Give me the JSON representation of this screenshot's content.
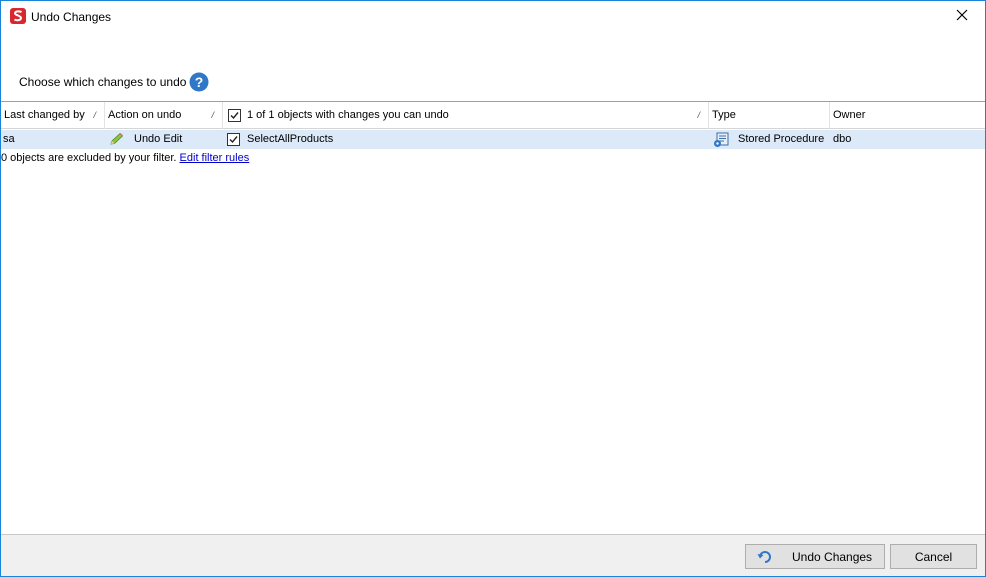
{
  "window": {
    "title": "Undo Changes"
  },
  "prompt": {
    "text": "Choose which changes to undo"
  },
  "grid": {
    "columns": {
      "last_changed_by": "Last changed by",
      "action_on_undo": "Action on undo",
      "objects_summary": "1 of 1 objects with changes you can undo",
      "type": "Type",
      "owner": "Owner"
    },
    "rows": [
      {
        "last_changed_by": "sa",
        "action": "Undo Edit",
        "checked": true,
        "object_name": "SelectAllProducts",
        "type": "Stored Procedure",
        "owner": "dbo"
      }
    ],
    "filter_note": "0 objects are excluded by your filter.",
    "filter_link": "Edit filter rules"
  },
  "footer": {
    "undo_button": "Undo Changes",
    "cancel_button": "Cancel"
  },
  "icons": {
    "app": "redgate-logo-icon",
    "help": "help-icon",
    "action": "pencil-icon",
    "type": "stored-procedure-icon",
    "undo": "undo-icon",
    "close": "close-icon"
  },
  "colors": {
    "window_border": "#1883d7",
    "selected_row": "#dce9f8",
    "link": "#0000cc",
    "app_icon": "#d9272e",
    "help_icon": "#2f77c7"
  }
}
